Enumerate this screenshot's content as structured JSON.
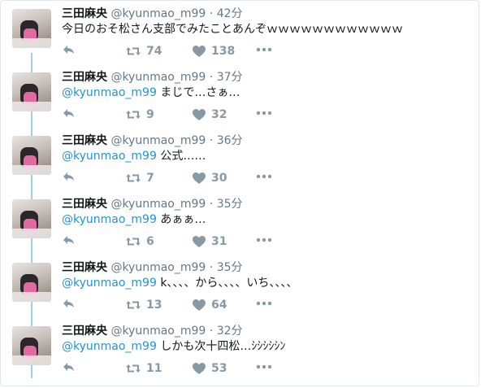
{
  "tweets": [
    {
      "name": "三田麻央",
      "handle": "@kyunmao_m99",
      "sep": "·",
      "time": "42分",
      "mention": "",
      "text": "今日のおそ松さん支部でみたことあんぞｗｗｗｗｗｗｗｗｗｗｗｗ",
      "retweets": "74",
      "likes": "138"
    },
    {
      "name": "三田麻央",
      "handle": "@kyunmao_m99",
      "sep": "·",
      "time": "37分",
      "mention": "@kyunmao_m99",
      "text": " まじで…さぁ…",
      "retweets": "9",
      "likes": "32"
    },
    {
      "name": "三田麻央",
      "handle": "@kyunmao_m99",
      "sep": "·",
      "time": "36分",
      "mention": "@kyunmao_m99",
      "text": " 公式……",
      "retweets": "7",
      "likes": "30"
    },
    {
      "name": "三田麻央",
      "handle": "@kyunmao_m99",
      "sep": "·",
      "time": "35分",
      "mention": "@kyunmao_m99",
      "text": " あぁぁ…",
      "retweets": "6",
      "likes": "31"
    },
    {
      "name": "三田麻央",
      "handle": "@kyunmao_m99",
      "sep": "·",
      "time": "35分",
      "mention": "@kyunmao_m99",
      "text": "  k、、、、から、、、、いち、、、、",
      "retweets": "13",
      "likes": "64"
    },
    {
      "name": "三田麻央",
      "handle": "@kyunmao_m99",
      "sep": "·",
      "time": "32分",
      "mention": "@kyunmao_m99",
      "text": " しかも次十四松…ｼｼｼｼｼﾝ",
      "retweets": "11",
      "likes": "53"
    }
  ],
  "icons": {
    "reply": "reply-icon",
    "retweet": "retweet-icon",
    "like": "heart-icon",
    "more": "more-icon"
  },
  "colors": {
    "mention": "#1b95e0",
    "action": "#8899a6",
    "connector": "#9ccfe6",
    "muted": "#657786"
  }
}
